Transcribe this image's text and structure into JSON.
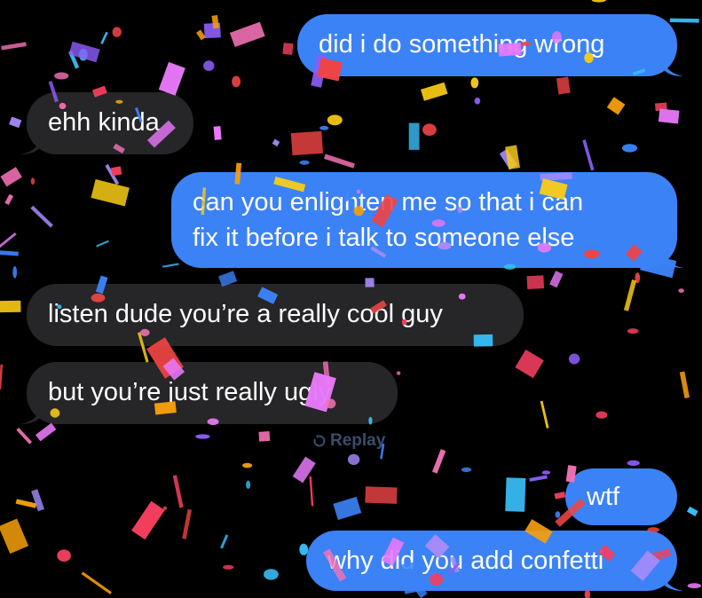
{
  "conversation": {
    "messages": [
      {
        "direction": "sent",
        "text": "did i do something wrong"
      },
      {
        "direction": "received",
        "text": "ehh kinda"
      },
      {
        "direction": "sent",
        "lines": [
          "can you enlighten me so that i can",
          "fix it before i talk to someone else"
        ]
      },
      {
        "direction": "received",
        "text": "listen dude you’re a really cool guy"
      },
      {
        "direction": "received",
        "text": "but you’re just really ugly"
      },
      {
        "direction": "sent",
        "text": "wtf"
      },
      {
        "direction": "sent",
        "text": "why did you add confetti"
      }
    ],
    "replay_label": "Replay"
  },
  "effect": {
    "name": "confetti",
    "icon": "replay-icon",
    "colors": [
      "#f43f5e",
      "#8b5cf6",
      "#3b82f6",
      "#facc15",
      "#f472b6",
      "#ef4444",
      "#38bdf8",
      "#a78bfa",
      "#f59e0b",
      "#e879f9"
    ]
  },
  "theme": {
    "background": "#000000",
    "sent_bubble": "#3b82f6",
    "received_bubble": "#262628",
    "text": "#ffffff"
  }
}
